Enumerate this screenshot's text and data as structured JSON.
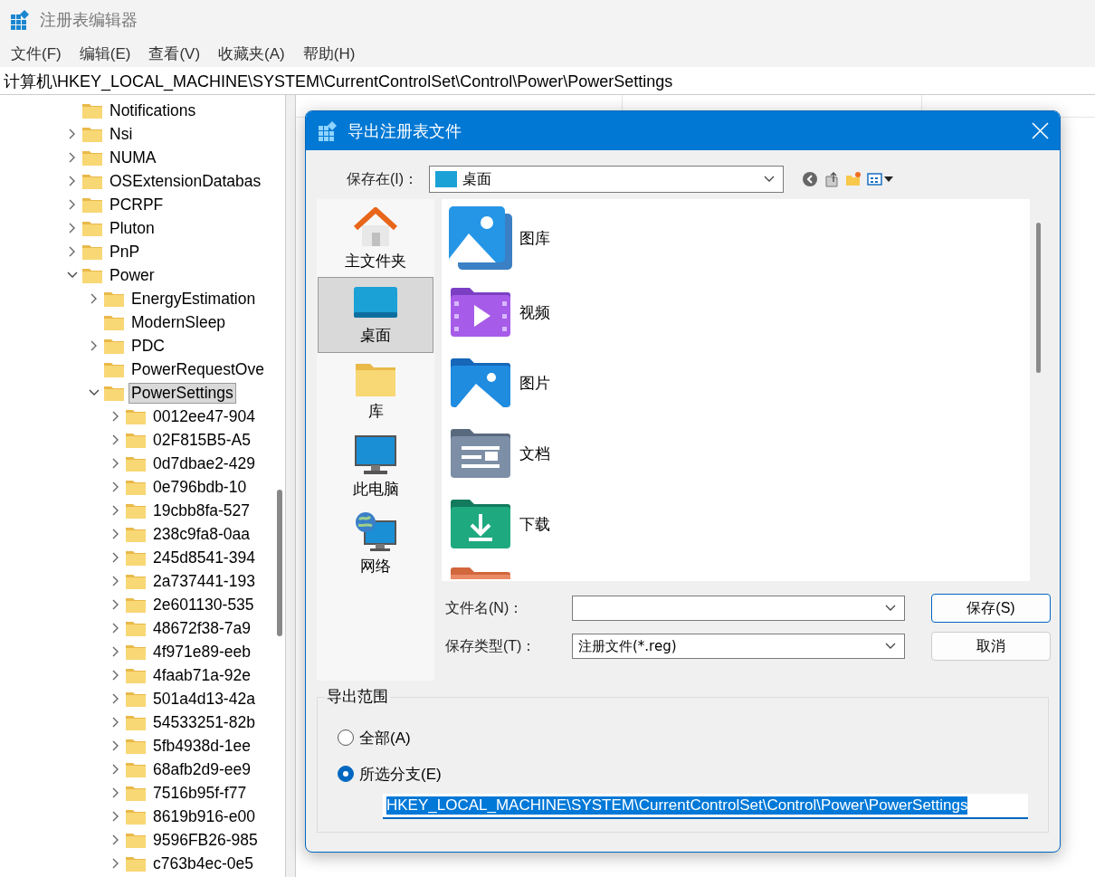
{
  "window": {
    "title": "注册表编辑器"
  },
  "menu": [
    {
      "label": "文件(F)"
    },
    {
      "label": "编辑(E)"
    },
    {
      "label": "查看(V)"
    },
    {
      "label": "收藏夹(A)"
    },
    {
      "label": "帮助(H)"
    }
  ],
  "address": "计算机\\HKEY_LOCAL_MACHINE\\SYSTEM\\CurrentControlSet\\Control\\Power\\PowerSettings",
  "tree": [
    {
      "label": "Notifications",
      "expandable": false,
      "expanded": false,
      "selected": false
    },
    {
      "label": "Nsi",
      "expandable": true,
      "expanded": false,
      "selected": false
    },
    {
      "label": "NUMA",
      "expandable": true,
      "expanded": false,
      "selected": false
    },
    {
      "label": "OSExtensionDatabas",
      "expandable": true,
      "expanded": false,
      "selected": false
    },
    {
      "label": "PCRPF",
      "expandable": true,
      "expanded": false,
      "selected": false
    },
    {
      "label": "Pluton",
      "expandable": true,
      "expanded": false,
      "selected": false
    },
    {
      "label": "PnP",
      "expandable": true,
      "expanded": false,
      "selected": false
    },
    {
      "label": "Power",
      "expandable": true,
      "expanded": true,
      "selected": false,
      "children": [
        {
          "label": "EnergyEstimation",
          "expandable": true,
          "expanded": false,
          "selected": false
        },
        {
          "label": "ModernSleep",
          "expandable": false,
          "expanded": false,
          "selected": false
        },
        {
          "label": "PDC",
          "expandable": true,
          "expanded": false,
          "selected": false
        },
        {
          "label": "PowerRequestOve",
          "expandable": false,
          "expanded": false,
          "selected": false
        },
        {
          "label": "PowerSettings",
          "expandable": true,
          "expanded": true,
          "selected": true,
          "children": [
            {
              "label": "0012ee47-904",
              "expandable": true,
              "expanded": false,
              "selected": false
            },
            {
              "label": "02F815B5-A5",
              "expandable": true,
              "expanded": false,
              "selected": false
            },
            {
              "label": "0d7dbae2-429",
              "expandable": true,
              "expanded": false,
              "selected": false
            },
            {
              "label": "0e796bdb-10",
              "expandable": true,
              "expanded": false,
              "selected": false
            },
            {
              "label": "19cbb8fa-527",
              "expandable": true,
              "expanded": false,
              "selected": false
            },
            {
              "label": "238c9fa8-0aa",
              "expandable": true,
              "expanded": false,
              "selected": false
            },
            {
              "label": "245d8541-394",
              "expandable": true,
              "expanded": false,
              "selected": false
            },
            {
              "label": "2a737441-193",
              "expandable": true,
              "expanded": false,
              "selected": false
            },
            {
              "label": "2e601130-535",
              "expandable": true,
              "expanded": false,
              "selected": false
            },
            {
              "label": "48672f38-7a9",
              "expandable": true,
              "expanded": false,
              "selected": false
            },
            {
              "label": "4f971e89-eeb",
              "expandable": true,
              "expanded": false,
              "selected": false
            },
            {
              "label": "4faab71a-92e",
              "expandable": true,
              "expanded": false,
              "selected": false
            },
            {
              "label": "501a4d13-42a",
              "expandable": true,
              "expanded": false,
              "selected": false
            },
            {
              "label": "54533251-82b",
              "expandable": true,
              "expanded": false,
              "selected": false
            },
            {
              "label": "5fb4938d-1ee",
              "expandable": true,
              "expanded": false,
              "selected": false
            },
            {
              "label": "68afb2d9-ee9",
              "expandable": true,
              "expanded": false,
              "selected": false
            },
            {
              "label": "7516b95f-f77",
              "expandable": true,
              "expanded": false,
              "selected": false
            },
            {
              "label": "8619b916-e00",
              "expandable": true,
              "expanded": false,
              "selected": false
            },
            {
              "label": "9596FB26-985",
              "expandable": true,
              "expanded": false,
              "selected": false
            },
            {
              "label": "c763b4ec-0e5",
              "expandable": true,
              "expanded": false,
              "selected": false
            }
          ]
        }
      ]
    }
  ],
  "dialog": {
    "title": "导出注册表文件",
    "save_in": {
      "label": "保存在(I)：",
      "value": "桌面"
    },
    "places": [
      {
        "label": "主文件夹",
        "kind": "home",
        "selected": false
      },
      {
        "label": "桌面",
        "kind": "desktop",
        "selected": true
      },
      {
        "label": "库",
        "kind": "library",
        "selected": false
      },
      {
        "label": "此电脑",
        "kind": "pc",
        "selected": false
      },
      {
        "label": "网络",
        "kind": "network",
        "selected": false
      }
    ],
    "files": [
      {
        "name": "图库",
        "kind": "gallery"
      },
      {
        "name": "视频",
        "kind": "video"
      },
      {
        "name": "图片",
        "kind": "pictures"
      },
      {
        "name": "文档",
        "kind": "documents"
      },
      {
        "name": "下载",
        "kind": "downloads"
      },
      {
        "kind": "music"
      }
    ],
    "file_name": {
      "label": "文件名(N)："
    },
    "file_type": {
      "label": "保存类型(T)：",
      "value": "注册文件(*.reg)"
    },
    "buttons": [
      {
        "label": "保存(S)",
        "default": true
      },
      {
        "label": "取消",
        "default": false
      }
    ],
    "export_range": {
      "title": "导出范围",
      "options": [
        {
          "label": "全部(A)",
          "selected": false
        },
        {
          "label": "所选分支(E)",
          "selected": true
        }
      ],
      "branch": "HKEY_LOCAL_MACHINE\\SYSTEM\\CurrentControlSet\\Control\\Power\\PowerSettings"
    }
  }
}
